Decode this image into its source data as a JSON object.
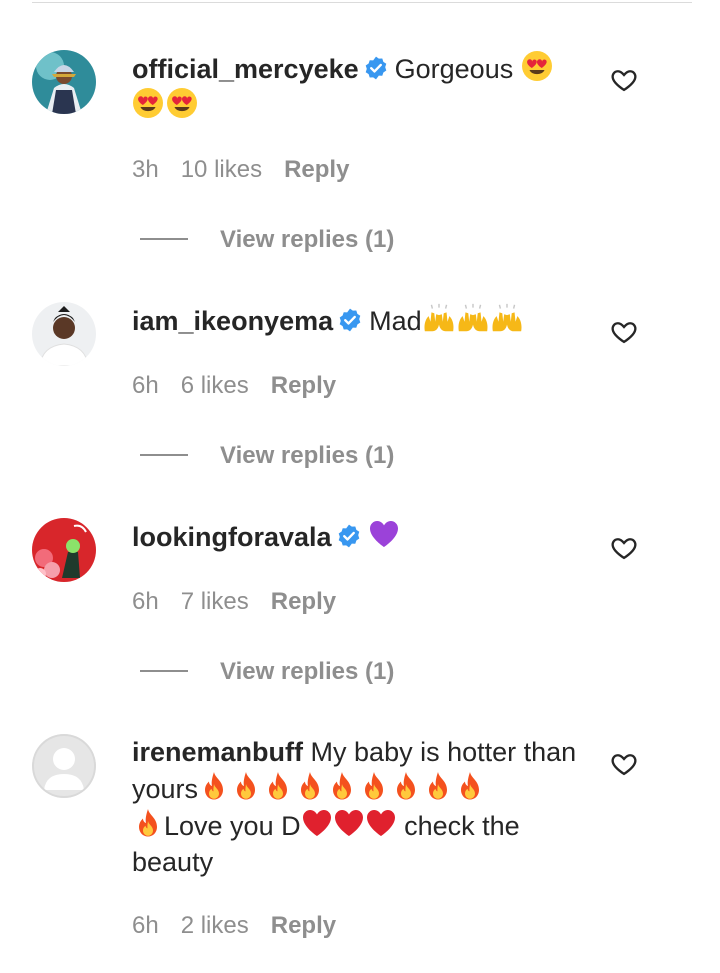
{
  "comments": [
    {
      "username": "official_mercyeke",
      "verified": true,
      "text_before": "Gorgeous",
      "text_after": "",
      "time": "3h",
      "likes": "10 likes",
      "reply": "Reply",
      "view_replies": "View replies (1)"
    },
    {
      "username": "iam_ikeonyema",
      "verified": true,
      "text_before": "Mad",
      "text_after": "",
      "time": "6h",
      "likes": "6 likes",
      "reply": "Reply",
      "view_replies": "View replies (1)"
    },
    {
      "username": "lookingforavala",
      "verified": true,
      "text_before": "",
      "text_after": "",
      "time": "6h",
      "likes": "7 likes",
      "reply": "Reply",
      "view_replies": "View replies (1)"
    },
    {
      "username": "irenemanbuff",
      "verified": false,
      "text_part1": "My baby is hotter than yours",
      "text_part2": "Love you D",
      "text_part3": "check the beauty",
      "time": "6h",
      "likes": "2 likes",
      "reply": "Reply"
    }
  ],
  "icons": {
    "like": "heart-outline-icon",
    "verified": "verified-badge-icon",
    "emojis": [
      "heart-eyes-emoji",
      "raising-hands-emoji",
      "purple-heart-emoji",
      "fire-emoji",
      "red-heart-emoji"
    ]
  },
  "colors": {
    "text": "#262626",
    "meta": "#8e8e8e",
    "verified": "#3897f0",
    "divider": "#dbdbdb"
  }
}
